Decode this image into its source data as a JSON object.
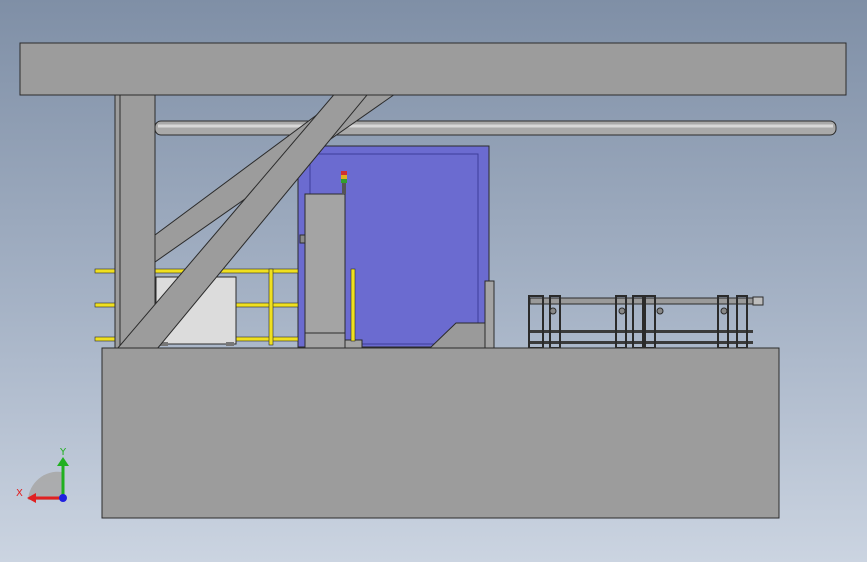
{
  "viewport": {
    "background_top": "#7f8fa6",
    "background_bottom": "#cbd4e1"
  },
  "colors": {
    "frame_gray": "#9c9c9c",
    "edge_dark": "#2b2b2b",
    "door_blue": "#6b6bd0",
    "railing_yellow": "#f0e020",
    "cabinet_light": "#dcdcdc",
    "conveyor_dark": "#3a3a3a"
  },
  "triad": {
    "x_label": "X",
    "y_label": "Y",
    "x_color": "#e02020",
    "y_color": "#20b020",
    "z_color": "#2020e0",
    "icon": "coordinate-triad-icon"
  }
}
